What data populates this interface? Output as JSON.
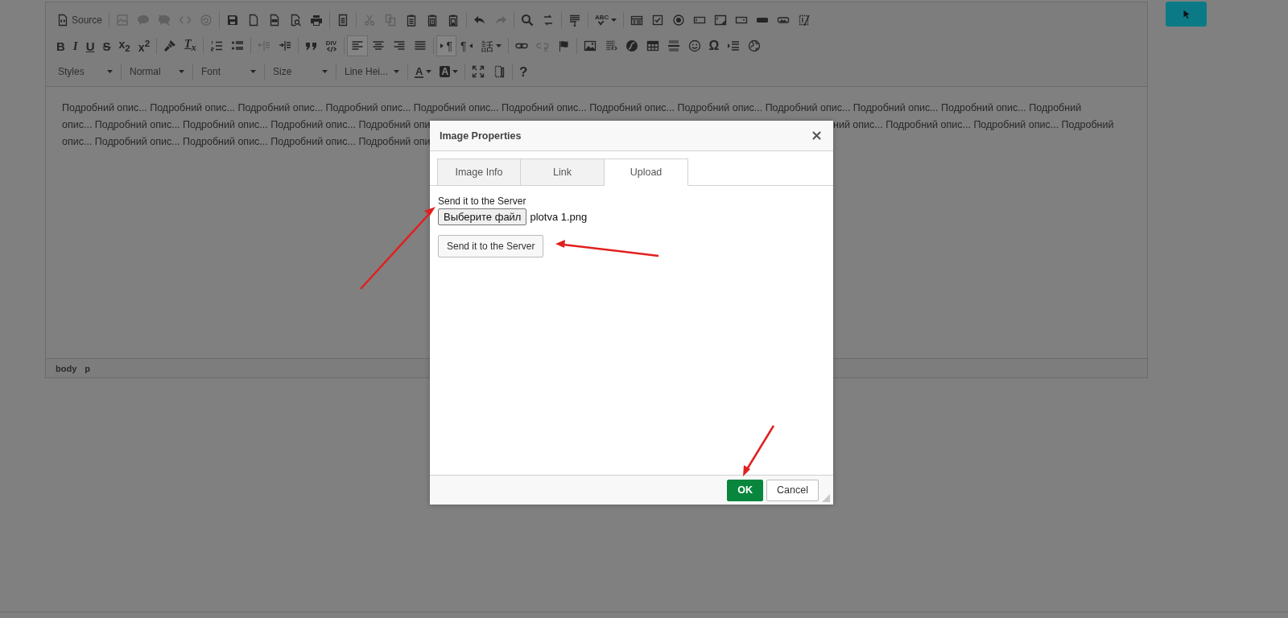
{
  "toolbar": {
    "rows": [
      [
        [
          {
            "kind": "source",
            "label": "Source",
            "disabled": false
          }
        ],
        [
          {
            "kind": "frame",
            "disabled": true
          },
          {
            "kind": "bubble",
            "disabled": true
          },
          {
            "kind": "bubble-slash",
            "disabled": true
          },
          {
            "kind": "code",
            "disabled": true
          },
          {
            "kind": "swirl",
            "disabled": true
          }
        ],
        [
          {
            "kind": "save",
            "disabled": false
          },
          {
            "kind": "new-page",
            "disabled": false
          },
          {
            "kind": "pdf",
            "disabled": false
          },
          {
            "kind": "preview",
            "disabled": false
          },
          {
            "kind": "print",
            "disabled": false
          }
        ],
        [
          {
            "kind": "templates",
            "disabled": false
          }
        ],
        [
          {
            "kind": "cut",
            "disabled": true
          },
          {
            "kind": "copy",
            "disabled": true
          },
          {
            "kind": "paste",
            "disabled": false
          },
          {
            "kind": "paste-text",
            "disabled": false
          },
          {
            "kind": "paste-word",
            "disabled": false
          }
        ],
        [
          {
            "kind": "undo",
            "disabled": false
          },
          {
            "kind": "redo",
            "disabled": true
          }
        ],
        [
          {
            "kind": "find",
            "disabled": false
          },
          {
            "kind": "replace",
            "disabled": false
          }
        ],
        [
          {
            "kind": "select-all",
            "disabled": false
          }
        ],
        [
          {
            "kind": "spellcheck",
            "label": "ABC",
            "disabled": false
          }
        ],
        [
          {
            "kind": "form",
            "disabled": false
          },
          {
            "kind": "checkbox",
            "disabled": false
          },
          {
            "kind": "radio",
            "disabled": false
          },
          {
            "kind": "text-field",
            "disabled": false
          },
          {
            "kind": "text-area",
            "disabled": false
          },
          {
            "kind": "select",
            "disabled": false
          },
          {
            "kind": "button",
            "disabled": false
          },
          {
            "kind": "image-button",
            "disabled": false
          },
          {
            "kind": "hidden-field",
            "disabled": false
          }
        ]
      ],
      [
        [
          {
            "kind": "bold",
            "label": "B",
            "disabled": false,
            "on": false
          },
          {
            "kind": "italic",
            "label": "I",
            "disabled": false,
            "on": false
          },
          {
            "kind": "underline",
            "label": "U",
            "disabled": false,
            "on": false
          },
          {
            "kind": "strike",
            "label": "S",
            "disabled": false,
            "on": false
          },
          {
            "kind": "subscript",
            "label": "x$_{2}$",
            "disabled": false,
            "on": false
          },
          {
            "kind": "superscript",
            "label": "x$^{2}$",
            "disabled": false,
            "on": false
          }
        ],
        [
          {
            "kind": "copy-format",
            "disabled": false,
            "on": false
          },
          {
            "kind": "remove-format",
            "label": "T$_{x}$",
            "disabled": false,
            "on": false
          }
        ],
        [
          {
            "kind": "numbered-list",
            "disabled": false,
            "on": false
          },
          {
            "kind": "bulleted-list",
            "disabled": false,
            "on": false
          }
        ],
        [
          {
            "kind": "outdent",
            "disabled": true,
            "on": false
          },
          {
            "kind": "indent",
            "disabled": false,
            "on": false
          }
        ],
        [
          {
            "kind": "blockquote",
            "disabled": false,
            "on": false
          },
          {
            "kind": "div",
            "label": "DIV",
            "disabled": false,
            "on": false
          }
        ],
        [
          {
            "kind": "align-left",
            "disabled": false,
            "on": true
          },
          {
            "kind": "align-center",
            "disabled": false,
            "on": false
          },
          {
            "kind": "align-right",
            "disabled": false,
            "on": false
          },
          {
            "kind": "justify",
            "disabled": false,
            "on": false
          }
        ],
        [
          {
            "kind": "ltr",
            "label": "¶",
            "disabled": false,
            "on": true
          },
          {
            "kind": "rtl",
            "label": "¶",
            "disabled": false,
            "on": false
          },
          {
            "kind": "language",
            "label": "話",
            "disabled": false,
            "on": false
          }
        ],
        [
          {
            "kind": "link",
            "disabled": false,
            "on": false
          },
          {
            "kind": "unlink",
            "disabled": true,
            "on": false
          },
          {
            "kind": "anchor",
            "disabled": false,
            "on": false
          }
        ],
        [
          {
            "kind": "image",
            "disabled": false,
            "on": false
          },
          {
            "kind": "embed",
            "disabled": false,
            "on": false
          },
          {
            "kind": "flash",
            "disabled": false,
            "on": false
          },
          {
            "kind": "table",
            "disabled": false,
            "on": false
          },
          {
            "kind": "horizontal-rule",
            "disabled": false,
            "on": false
          },
          {
            "kind": "smiley",
            "disabled": false,
            "on": false
          },
          {
            "kind": "special-char",
            "label": "Ω",
            "disabled": false,
            "on": false
          },
          {
            "kind": "page-break",
            "disabled": false,
            "on": false
          },
          {
            "kind": "iframe",
            "disabled": false,
            "on": false
          }
        ]
      ],
      [
        [
          {
            "kind": "combo",
            "label": "Styles",
            "disabled": false
          }
        ],
        [
          {
            "kind": "combo",
            "label": "Normal",
            "disabled": false
          }
        ],
        [
          {
            "kind": "combo",
            "label": "Font",
            "disabled": false
          }
        ],
        [
          {
            "kind": "combo",
            "label": "Size",
            "disabled": false
          }
        ],
        [
          {
            "kind": "combo",
            "label": "Line Hei...",
            "disabled": false
          }
        ],
        [
          {
            "kind": "text-color",
            "label": "A",
            "disabled": false
          },
          {
            "kind": "background-color",
            "label": "A",
            "disabled": false
          }
        ],
        [
          {
            "kind": "maximize",
            "disabled": false
          },
          {
            "kind": "show-blocks",
            "disabled": false
          }
        ],
        [
          {
            "kind": "about",
            "label": "?",
            "disabled": false
          }
        ]
      ]
    ]
  },
  "content_lines": [
    {
      "segments": [
        "Подробний опис... Подробний опис... Подробний опис... Подробний опис... Подробний опис... Подробний опис... Подробний опис... Подробний опис... Подробний опис... Подробний опис... Подробний опис... Подробний"
      ]
    },
    {
      "segments": [
        "опис... Подробний опис... Подробний опис... Подробний опис... Подробний опи",
        "ний опис... Подробний опис... Подробний опис... Подробний"
      ]
    },
    {
      "segments": [
        "опис... Подробний опис... Подробний опис... Подробний опис... Подробний опи"
      ]
    }
  ],
  "element_path": [
    "body",
    "p"
  ],
  "dialog": {
    "title": "Image Properties",
    "tabs": [
      {
        "label": "Image Info",
        "selected": false
      },
      {
        "label": "Link",
        "selected": false
      },
      {
        "label": "Upload",
        "selected": true
      }
    ],
    "section_label": "Send it to the Server",
    "file_button": "Выберите файл",
    "file_name": "plotva 1.png",
    "send_button": "Send it to the Server",
    "buttons": [
      {
        "kind": "ok",
        "label": "OK"
      },
      {
        "kind": "cancel",
        "label": "Cancel"
      }
    ]
  }
}
